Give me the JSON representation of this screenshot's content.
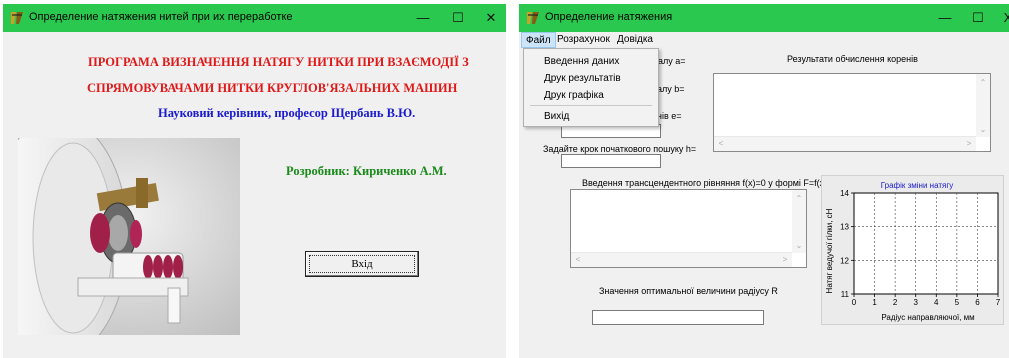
{
  "window1": {
    "title": "Определение натяжения нитей при их переработке",
    "heading_line1": "ПРОГРАМА ВИЗНАЧЕННЯ НАТЯГУ НИТКИ ПРИ ВЗАЄМОДІЇ З",
    "heading_line2": "СПРЯМОВУВАЧАМИ НИТКИ КРУГЛОВ'ЯЗАЛЬНИХ МАШИН",
    "supervisor": "Науковий керівник, професор Щербань В.Ю.",
    "developer": "Розробник: Кириченко А.М.",
    "enter_button": "Вхід",
    "controls": {
      "minimize": "—",
      "maximize": "☐",
      "close": "✕"
    }
  },
  "window2": {
    "title": "Определение натяжения",
    "controls": {
      "minimize": "—",
      "maximize": "☐",
      "close": "X"
    },
    "menu": [
      "Файл",
      "Розрахунок",
      "Довідка"
    ],
    "file_menu": [
      "Введення даних",
      "Друк результатів",
      "Друк графіка",
      "Вихід"
    ],
    "label_a": "алу  а=",
    "label_b": "алу b=",
    "label_e": "нів е=",
    "label_h": "Задайте крок початкового пошуку h=",
    "results_label": "Результати обчислення коренів",
    "equation_label": "Введення трансцендентного рівняння f(x)=0  у формі F=f(x)",
    "optimal_label": "Значення оптимальної величини радіусу R",
    "scroll": {
      "up": "⌃",
      "down": "⌄",
      "left": "<",
      "right": ">"
    }
  },
  "chart_data": {
    "type": "line",
    "title": "Графік зміни натягу",
    "xlabel": "Радіус направляючої, мм",
    "ylabel": "Натяг ведучої гілки, сН",
    "xlim": [
      0,
      7
    ],
    "ylim": [
      11,
      14
    ],
    "x_ticks": [
      "0",
      "1",
      "2",
      "3",
      "4",
      "5",
      "6",
      "7"
    ],
    "y_ticks": [
      "11",
      "12",
      "13",
      "14"
    ],
    "grid": true,
    "series": [],
    "title_color": "#1a1ad0"
  },
  "colors": {
    "titlebar": "#2ac84e",
    "heading": "#e01818",
    "supervisor": "#1a1ad0",
    "developer": "#1a8a1a"
  }
}
